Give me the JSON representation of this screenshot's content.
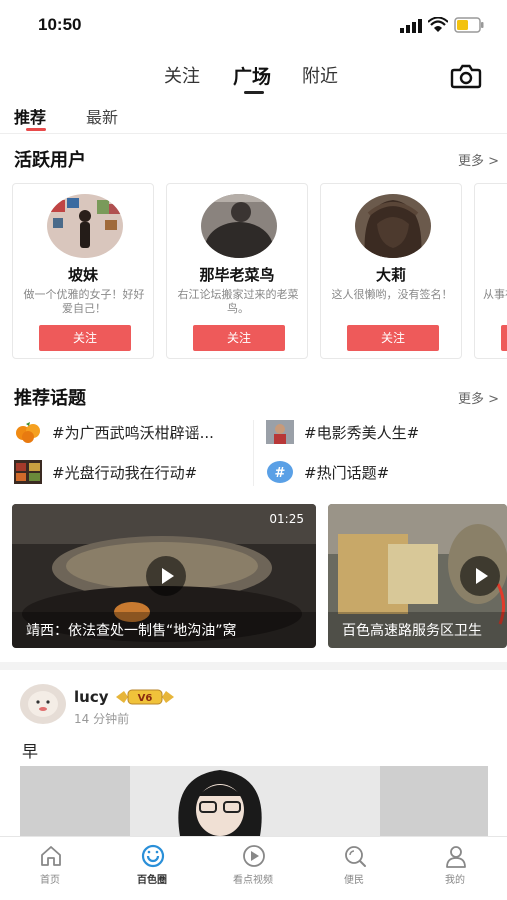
{
  "status": {
    "time": "10:50"
  },
  "top_tabs": [
    "关注",
    "广场",
    "附近"
  ],
  "sub_tabs": [
    "推荐",
    "最新"
  ],
  "active_users": {
    "title": "活跃用户",
    "more": "更多 >",
    "users": [
      {
        "name": "坡妹",
        "desc": "做一个优雅的女子！好好爱自己！",
        "button": "关注"
      },
      {
        "name": "那毕老菜鸟",
        "desc": "右江论坛搬家过来的老菜鸟。",
        "button": "关注"
      },
      {
        "name": "大莉",
        "desc": "这人很懒哟，没有签名！",
        "button": "关注"
      },
      {
        "name": "",
        "desc": "从事在百",
        "button": ""
      }
    ]
  },
  "topics": {
    "title": "推荐话题",
    "more": "更多 >",
    "items": [
      {
        "text": "#为广西武鸣沃柑辟谣...",
        "icon": "orange-fruit-icon"
      },
      {
        "text": "#电影秀美人生#",
        "icon": "film-thumbnail-icon"
      },
      {
        "text": "#光盘行动我在行动#",
        "icon": "food-thumbnail-icon"
      },
      {
        "text": "#热门话题#",
        "icon": "hashtag-icon"
      }
    ]
  },
  "videos": [
    {
      "caption": "靖西：依法查处一制售“地沟油”窝",
      "duration": "01:25"
    },
    {
      "caption": "百色高速路服务区卫生"
    }
  ],
  "post": {
    "user": "lucy",
    "badge": "V6",
    "time": "14 分钟前",
    "text": "早"
  },
  "tabbar": [
    {
      "label": "首页",
      "icon": "home-icon",
      "active": false
    },
    {
      "label": "百色圈",
      "icon": "circle-icon",
      "active": true
    },
    {
      "label": "看点视频",
      "icon": "play-icon",
      "active": false
    },
    {
      "label": "便民",
      "icon": "search-icon",
      "active": false
    },
    {
      "label": "我的",
      "icon": "profile-icon",
      "active": false
    }
  ],
  "colors": {
    "accent": "#ee5a5a",
    "active_tab": "#2a8fd8"
  }
}
